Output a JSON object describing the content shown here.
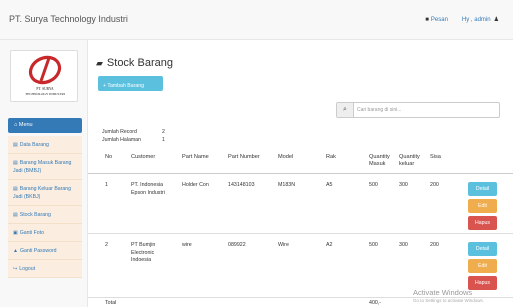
{
  "header": {
    "brand": "PT. Surya Technology Industri",
    "pesan_label": "Pesan",
    "user_label": "Hy , admin"
  },
  "sidebar": {
    "logo_line1": "PT. SURYA",
    "logo_line2": "TECHNOLOGY INDUSTRI",
    "menu_title": "Menu",
    "items": [
      {
        "label": "Data Barang",
        "icon": "database-icon"
      },
      {
        "label": "Barang Masuk Barang Jadi (BMBJ)",
        "icon": "database-icon"
      },
      {
        "label": "Barang Keluar Barang Jadi (BKBJ)",
        "icon": "database-icon"
      },
      {
        "label": "Stock Barang",
        "icon": "database-icon"
      },
      {
        "label": "Ganti Foto",
        "icon": "image-icon"
      },
      {
        "label": "Ganti Password",
        "icon": "lock-icon"
      },
      {
        "label": "Logout",
        "icon": "logout-icon"
      }
    ]
  },
  "main": {
    "title": "Stock Barang",
    "add_button": "+ Tambah Barang",
    "search_placeholder": "Cari barang di sini...",
    "info": {
      "record_label": "Jumlah Record",
      "record_value": "2",
      "page_label": "Jumlah Halaman",
      "page_value": "1"
    },
    "columns": {
      "no": "No",
      "customer": "Customer",
      "part_name": "Part Name",
      "part_number": "Part Number",
      "model": "Model",
      "rak": "Rak",
      "qty_masuk_1": "Quantity",
      "qty_masuk_2": "Masuk",
      "qty_keluar_1": "Quantity",
      "qty_keluar_2": "keluar",
      "sisa": "Sisa"
    },
    "rows": [
      {
        "no": "1",
        "customer_1": "PT. Indonesia",
        "customer_2": "Epson Industri",
        "customer_3": "",
        "part_name": "Holder Con",
        "part_number": "143148103",
        "model": "M183N",
        "rak": "A5",
        "qty_masuk": "500",
        "qty_keluar": "300",
        "sisa": "200"
      },
      {
        "no": "2",
        "customer_1": "PT Bumjin",
        "customer_2": "Electronic",
        "customer_3": "Indoesia",
        "part_name": "wire",
        "part_number": "089922",
        "model": "Wire",
        "rak": "A2",
        "qty_masuk": "500",
        "qty_keluar": "300",
        "sisa": "200"
      }
    ],
    "actions": {
      "detail": "Detail",
      "edit": "Edit",
      "hapus": "Hapus"
    },
    "total_label": "Total",
    "total_value": "400,-"
  },
  "watermark": {
    "line1": "Activate Windows",
    "line2": "Go to Settings to activate Windows."
  },
  "colors": {
    "primary": "#337ab7",
    "info": "#5bc0de",
    "warning": "#f0ad4e",
    "danger": "#d9534f",
    "menu_bg": "#fbeee0"
  }
}
